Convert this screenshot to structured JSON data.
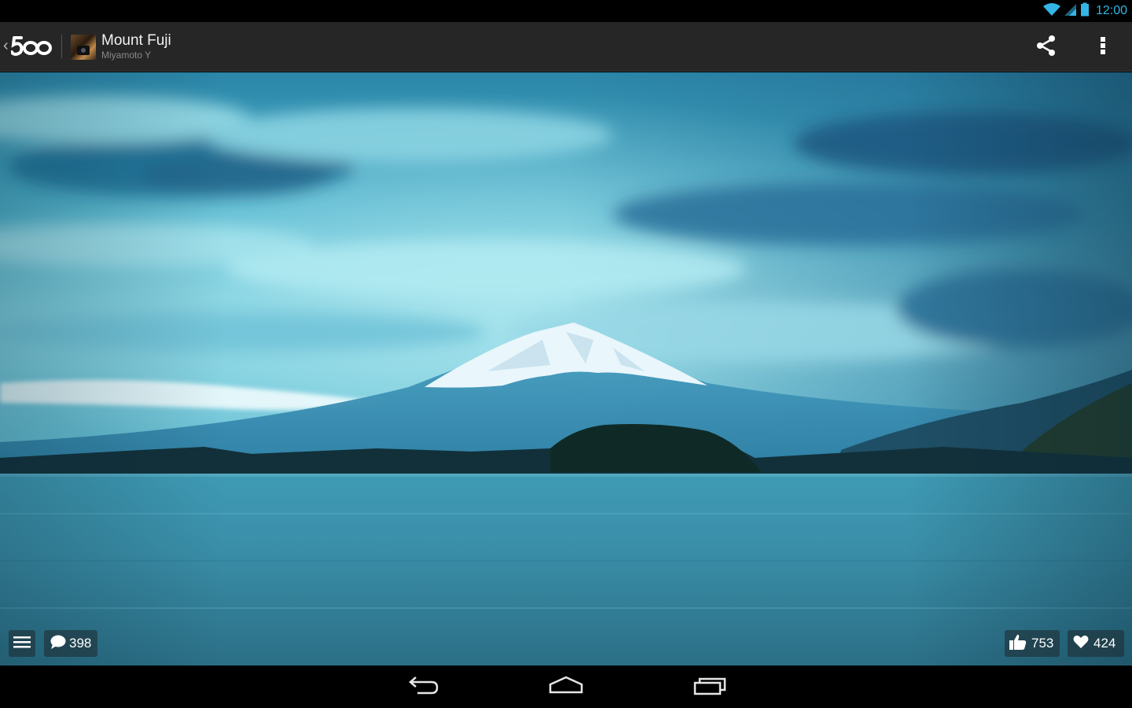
{
  "status_bar": {
    "time": "12:00",
    "icons": [
      "wifi-icon",
      "signal-icon",
      "battery-icon"
    ],
    "accent": "#33b5e5"
  },
  "action_bar": {
    "app_logo_text": "500",
    "photo_title": "Mount Fuji",
    "author": "Miyamoto Y",
    "icons": [
      "back-chevron-icon",
      "share-icon",
      "overflow-menu-icon"
    ],
    "background": "#262626"
  },
  "photo": {
    "subject": "mountain-lake-photo"
  },
  "overlay": {
    "comments_count": "398",
    "likes_count": "753",
    "favorites_count": "424",
    "icons": [
      "menu-icon",
      "comment-icon",
      "thumbs-up-icon",
      "heart-icon"
    ]
  },
  "nav_bar": {
    "icons": [
      "back-icon",
      "home-icon",
      "recent-apps-icon"
    ]
  }
}
